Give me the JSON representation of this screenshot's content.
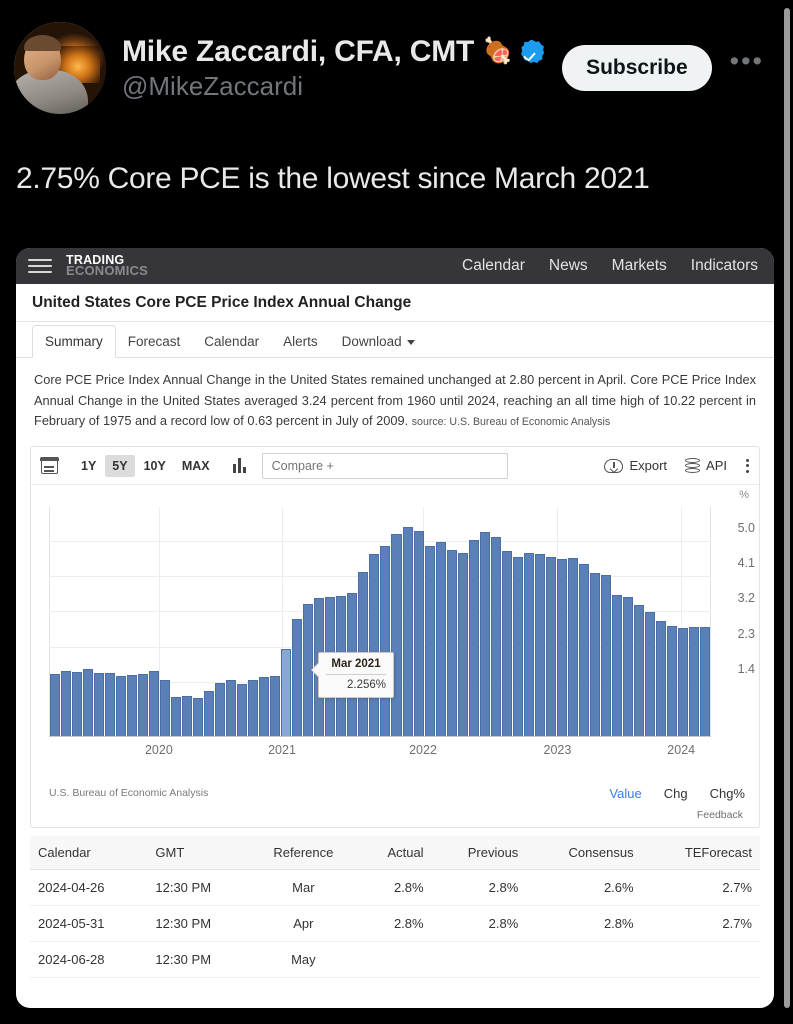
{
  "tweet": {
    "display_name": "Mike Zaccardi, CFA, CMT",
    "emoji": "🍖",
    "verified_icon": "verified-badge",
    "handle": "@MikeZaccardi",
    "subscribe_label": "Subscribe",
    "more_icon": "ellipsis-icon",
    "body": "2.75% Core PCE is the lowest since March 2021"
  },
  "card": {
    "topbar": {
      "menu_icon": "hamburger-icon",
      "logo_line1": "TRADING",
      "logo_line2": "ECONOMICS",
      "nav": [
        "Calendar",
        "News",
        "Markets",
        "Indicators"
      ]
    },
    "title": "United States Core PCE Price Index Annual Change",
    "tabs": [
      {
        "label": "Summary",
        "active": true
      },
      {
        "label": "Forecast",
        "active": false
      },
      {
        "label": "Calendar",
        "active": false
      },
      {
        "label": "Alerts",
        "active": false
      },
      {
        "label": "Download",
        "active": false,
        "caret": true
      }
    ],
    "blurb": "Core PCE Price Index Annual Change in the United States remained unchanged at 2.80 percent in April. Core PCE Price Index Annual Change in the United States averaged 3.24 percent from 1960 until 2024, reaching an all time high of 10.22 percent in February of 1975 and a record low of 0.63 percent in July of 2009.",
    "blurb_source": "source: U.S. Bureau of Economic Analysis",
    "toolbar": {
      "calendar_icon": "calendar-icon",
      "ranges": [
        {
          "label": "1Y",
          "active": false
        },
        {
          "label": "5Y",
          "active": true
        },
        {
          "label": "10Y",
          "active": false
        },
        {
          "label": "MAX",
          "active": false
        }
      ],
      "chart_type_icon": "bar-chart-icon",
      "compare_placeholder": "Compare +",
      "compare_value": "",
      "export_label": "Export",
      "export_icon": "cloud-download-icon",
      "api_label": "API",
      "api_icon": "database-icon",
      "menu_icon": "kebab-menu-icon"
    },
    "chart_footer": {
      "source": "U.S. Bureau of Economic Analysis",
      "toggles": [
        {
          "label": "Value",
          "active": true
        },
        {
          "label": "Chg",
          "active": false
        },
        {
          "label": "Chg%",
          "active": false
        }
      ],
      "feedback": "Feedback"
    },
    "table": {
      "headers": [
        "Calendar",
        "GMT",
        "Reference",
        "Actual",
        "Previous",
        "Consensus",
        "TEForecast"
      ],
      "rows": [
        [
          "2024-04-26",
          "12:30 PM",
          "Mar",
          "2.8%",
          "2.8%",
          "2.6%",
          "2.7%"
        ],
        [
          "2024-05-31",
          "12:30 PM",
          "Apr",
          "2.8%",
          "2.8%",
          "2.8%",
          "2.7%"
        ],
        [
          "2024-06-28",
          "12:30 PM",
          "May",
          "",
          "",
          "",
          ""
        ]
      ]
    }
  },
  "chart_data": {
    "type": "bar",
    "title": "United States Core PCE Price Index Annual Change",
    "xlabel": "",
    "ylabel": "%",
    "unit": "%",
    "ylim": [
      0,
      5.9
    ],
    "yticks": [
      1.4,
      2.3,
      3.2,
      4.1,
      5.0
    ],
    "ytick_labels": [
      "1.4",
      "2.3",
      "3.2",
      "4.1",
      "5.0"
    ],
    "xticks": [
      "2020",
      "2021",
      "2022",
      "2023",
      "2024"
    ],
    "xtick_positions_pct": [
      16.6,
      35.2,
      56.5,
      76.8,
      95.5
    ],
    "grid": true,
    "legend_position": "bottom-right",
    "bar_color": "#5b80b8",
    "highlight_color": "#89a7d3",
    "highlight_index": 21,
    "tooltip": {
      "label": "Mar 2021",
      "value": "2.256%"
    },
    "categories": [
      "Jun 2019",
      "Jul 2019",
      "Aug 2019",
      "Sep 2019",
      "Oct 2019",
      "Nov 2019",
      "Dec 2019",
      "Jan 2020",
      "Feb 2020",
      "Mar 2020",
      "Apr 2020",
      "May 2020",
      "Jun 2020",
      "Jul 2020",
      "Aug 2020",
      "Sep 2020",
      "Oct 2020",
      "Nov 2020",
      "Dec 2020",
      "Jan 2021",
      "Feb 2021",
      "Mar 2021",
      "Apr 2021",
      "May 2021",
      "Jun 2021",
      "Jul 2021",
      "Aug 2021",
      "Sep 2021",
      "Oct 2021",
      "Nov 2021",
      "Dec 2021",
      "Jan 2022",
      "Feb 2022",
      "Mar 2022",
      "Apr 2022",
      "May 2022",
      "Jun 2022",
      "Jul 2022",
      "Aug 2022",
      "Sep 2022",
      "Oct 2022",
      "Nov 2022",
      "Dec 2022",
      "Jan 2023",
      "Feb 2023",
      "Mar 2023",
      "Apr 2023",
      "May 2023",
      "Jun 2023",
      "Jul 2023",
      "Aug 2023",
      "Sep 2023",
      "Oct 2023",
      "Nov 2023",
      "Dec 2023",
      "Jan 2024",
      "Feb 2024",
      "Mar 2024",
      "Apr 2024"
    ],
    "values": [
      1.6,
      1.68,
      1.66,
      1.74,
      1.63,
      1.64,
      1.55,
      1.58,
      1.59,
      1.68,
      1.44,
      1.02,
      1.03,
      0.99,
      1.17,
      1.38,
      1.44,
      1.35,
      1.44,
      1.52,
      1.55,
      2.256,
      3.02,
      3.4,
      3.55,
      3.58,
      3.62,
      3.7,
      4.24,
      4.7,
      4.9,
      5.2,
      5.38,
      5.28,
      4.9,
      5.01,
      4.79,
      4.73,
      5.06,
      5.25,
      5.12,
      4.77,
      4.61,
      4.71,
      4.69,
      4.62,
      4.57,
      4.59,
      4.44,
      4.2,
      4.15,
      3.65,
      3.58,
      3.39,
      3.2,
      2.97,
      2.85,
      2.79,
      2.8,
      2.8
    ]
  }
}
